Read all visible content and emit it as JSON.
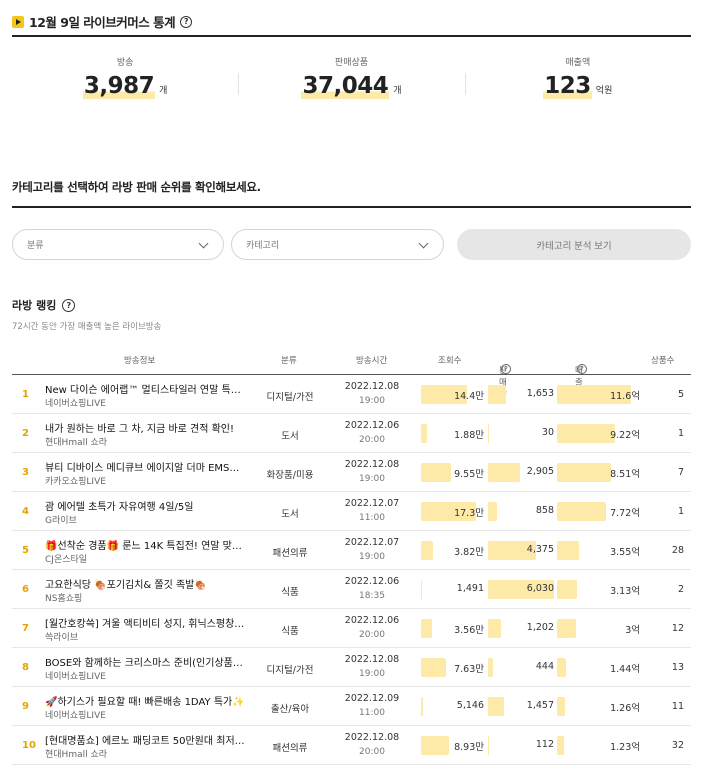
{
  "header": {
    "title": "12월 9일 라이브커머스 통계",
    "help": "?"
  },
  "stats": [
    {
      "label": "방송",
      "value": "3,987",
      "unit": "개"
    },
    {
      "label": "판매상품",
      "value": "37,044",
      "unit": "개"
    },
    {
      "label": "매출액",
      "value": "123",
      "unit": "억원"
    }
  ],
  "section": {
    "title": "카테고리를 선택하여 라방 판매 순위를 확인해보세요."
  },
  "filters": {
    "classification": "분류",
    "category": "카테고리",
    "analyze_button": "카테고리 분석 보기"
  },
  "ranking": {
    "title": "라방 랭킹",
    "help": "?",
    "subtitle": "72시간 동안 가장 매출액 높은 라이브방송",
    "columns": {
      "info": "방송정보",
      "category": "분류",
      "time": "방송시간",
      "views": "조회수",
      "sales": "판매량",
      "revenue": "매출액",
      "goods": "상품수"
    },
    "rows": [
      {
        "rank": "1",
        "title": "New 다이슨 에어랩™ 멀티스타일러 연말 특…",
        "channel": "네이버쇼핑LIVE",
        "category": "디지털/가전",
        "date": "2022.12.08",
        "time": "19:00",
        "views": "14.4만",
        "views_level": 0.73,
        "sales": "1,653",
        "sales_level": 0.27,
        "revenue": "11.6억",
        "revenue_level": 0.89,
        "goods": "5"
      },
      {
        "rank": "2",
        "title": "내가 원하는 바로 그 차, 지금 바로 견적 확인!",
        "channel": "현대Hmall 쇼라",
        "category": "도서",
        "date": "2022.12.06",
        "time": "20:00",
        "views": "1.88만",
        "views_level": 0.09,
        "sales": "30",
        "sales_level": 0.01,
        "revenue": "9.22억",
        "revenue_level": 0.7,
        "goods": "1"
      },
      {
        "rank": "3",
        "title": "뷰티 디바이스 메디큐브 에이지알 더마 EMS…",
        "channel": "카카오쇼핑LIVE",
        "category": "화장품/미용",
        "date": "2022.12.08",
        "time": "19:00",
        "views": "9.55만",
        "views_level": 0.48,
        "sales": "2,905",
        "sales_level": 0.48,
        "revenue": "8.51억",
        "revenue_level": 0.65,
        "goods": "7"
      },
      {
        "rank": "4",
        "title": "괌 에어텔 초특가 자유여행 4일/5일",
        "channel": "G라이브",
        "category": "도서",
        "date": "2022.12.07",
        "time": "11:00",
        "views": "17.3만",
        "views_level": 0.88,
        "sales": "858",
        "sales_level": 0.14,
        "revenue": "7.72억",
        "revenue_level": 0.59,
        "goods": "1"
      },
      {
        "rank": "5",
        "title": "🎁선착순 경품🎁 룬느 14K 특집전! 연말 맞…",
        "channel": "CJ온스타일",
        "category": "패션의류",
        "date": "2022.12.07",
        "time": "19:00",
        "views": "3.82만",
        "views_level": 0.19,
        "sales": "4,375",
        "sales_level": 0.72,
        "revenue": "3.55억",
        "revenue_level": 0.27,
        "goods": "28"
      },
      {
        "rank": "6",
        "title": "고요한식당 🍖포기김치& 쫄깃 족발🍖",
        "channel": "NS홈쇼핑",
        "category": "식품",
        "date": "2022.12.06",
        "time": "18:35",
        "views": "1,491",
        "views_level": 0.01,
        "sales": "6,030",
        "sales_level": 1.0,
        "revenue": "3.13억",
        "revenue_level": 0.24,
        "goods": "2"
      },
      {
        "rank": "7",
        "title": "[월간호캉쓱] 겨울 액티비티 성지, 휘닉스평창…",
        "channel": "쓱라이브",
        "category": "식품",
        "date": "2022.12.06",
        "time": "20:00",
        "views": "3.56만",
        "views_level": 0.18,
        "sales": "1,202",
        "sales_level": 0.2,
        "revenue": "3억",
        "revenue_level": 0.23,
        "goods": "12"
      },
      {
        "rank": "8",
        "title": "BOSE와 함께하는 크리스마스 준비(인기상품…",
        "channel": "네이버쇼핑LIVE",
        "category": "디지털/가전",
        "date": "2022.12.08",
        "time": "19:00",
        "views": "7.63만",
        "views_level": 0.39,
        "sales": "444",
        "sales_level": 0.07,
        "revenue": "1.44억",
        "revenue_level": 0.11,
        "goods": "13"
      },
      {
        "rank": "9",
        "title": "🚀하기스가 필요할 때! 빠른배송 1DAY 특가✨",
        "channel": "네이버쇼핑LIVE",
        "category": "출산/육아",
        "date": "2022.12.09",
        "time": "11:00",
        "views": "5,146",
        "views_level": 0.03,
        "sales": "1,457",
        "sales_level": 0.24,
        "revenue": "1.26억",
        "revenue_level": 0.1,
        "goods": "11"
      },
      {
        "rank": "10",
        "title": "[현대명품쇼] 에르노 패딩코트 50만원대 최저…",
        "channel": "현대Hmall 쇼라",
        "category": "패션의류",
        "date": "2022.12.08",
        "time": "20:00",
        "views": "8.93만",
        "views_level": 0.45,
        "sales": "112",
        "sales_level": 0.02,
        "revenue": "1.23억",
        "revenue_level": 0.09,
        "goods": "32"
      }
    ]
  },
  "colors": {
    "accent": "#f5c518",
    "bar": "#fde9a8",
    "rank": "#e4a400"
  }
}
